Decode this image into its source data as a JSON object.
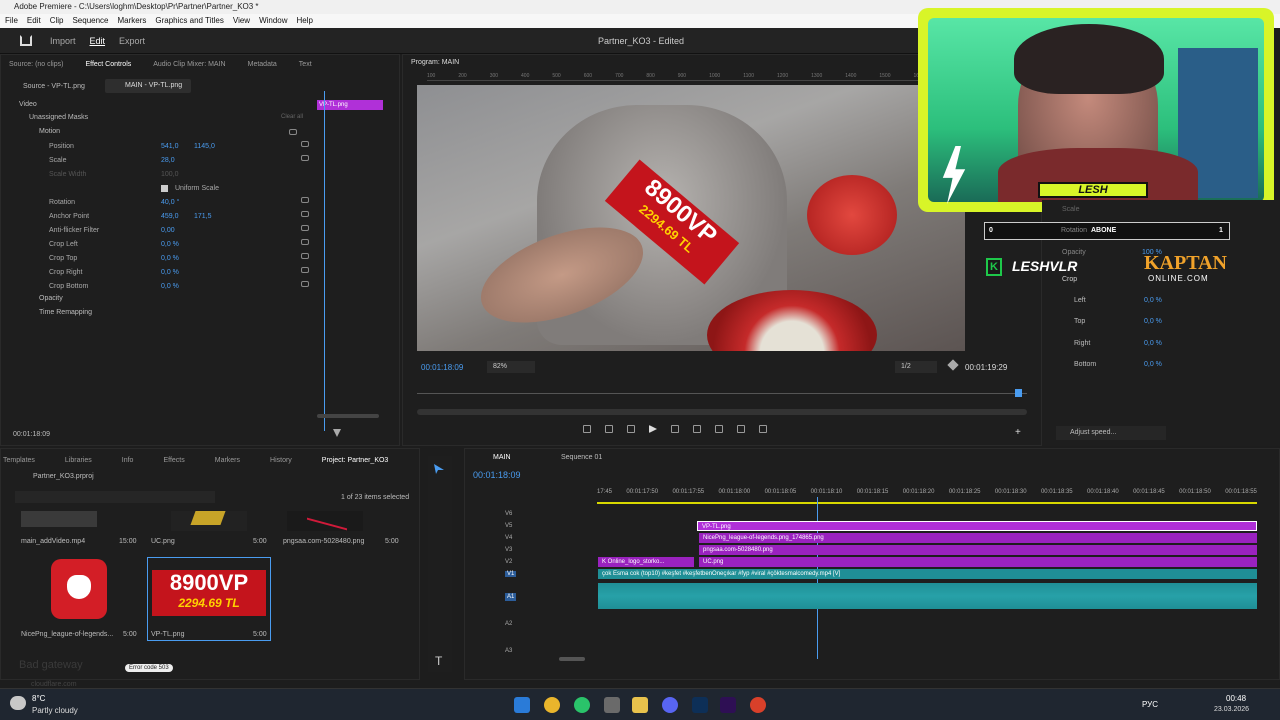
{
  "window": {
    "title": "Adobe Premiere - C:\\Users\\loghm\\Desktop\\Pr\\Partner\\Partner_KO3 *"
  },
  "menu": [
    "File",
    "Edit",
    "Clip",
    "Sequence",
    "Markers",
    "Graphics and Titles",
    "View",
    "Window",
    "Help"
  ],
  "workspace_tabs": {
    "import": "Import",
    "edit": "Edit",
    "export": "Export"
  },
  "project_title": "Partner_KO3 - Edited",
  "effect_controls": {
    "tabs": [
      "Source: (no clips)",
      "Effect Controls",
      "Audio Clip Mixer: MAIN",
      "Metadata",
      "Text"
    ],
    "source_clip": "Source - VP-TL.png",
    "main_clip": "MAIN - VP-TL.png",
    "timeline_clip": "VP-TL.png",
    "video_label": "Video",
    "unassigned_masks": "Unassigned Masks",
    "clear_all": "Clear all",
    "motion": "Motion",
    "rows": [
      {
        "name": "Position",
        "v1": "541,0",
        "v2": "1145,0"
      },
      {
        "name": "Scale",
        "v1": "28,0",
        "v2": ""
      },
      {
        "name": "Scale Width",
        "v1": "100,0",
        "v2": ""
      },
      {
        "name": "Uniform Scale",
        "v1": "",
        "v2": ""
      },
      {
        "name": "Rotation",
        "v1": "40,0 °",
        "v2": ""
      },
      {
        "name": "Anchor Point",
        "v1": "459,0",
        "v2": "171,5"
      },
      {
        "name": "Anti-flicker Filter",
        "v1": "0,00",
        "v2": ""
      },
      {
        "name": "Crop Left",
        "v1": "0,0 %",
        "v2": ""
      },
      {
        "name": "Crop Top",
        "v1": "0,0 %",
        "v2": ""
      },
      {
        "name": "Crop Right",
        "v1": "0,0 %",
        "v2": ""
      },
      {
        "name": "Crop Bottom",
        "v1": "0,0 %",
        "v2": ""
      }
    ],
    "opacity": "Opacity",
    "time_remapping": "Time Remapping",
    "timecode": "00:01:18:09"
  },
  "program": {
    "title": "Program: MAIN",
    "ruler": [
      "100",
      "200",
      "300",
      "400",
      "500",
      "600",
      "700",
      "800",
      "900",
      "1000",
      "1100",
      "1200",
      "1300",
      "1400",
      "1500",
      "1600",
      "1700",
      "1800",
      "1900"
    ],
    "left_timecode": "00:01:18:09",
    "zoom": "82%",
    "resolution": "1/2",
    "right_timecode": "00:01:19:29",
    "overlay_top": "8900VP",
    "overlay_bottom": "2294.69 TL"
  },
  "stream_overlay": {
    "name": "LESH",
    "rotation_label": "Rotation",
    "abone": "ABONE",
    "counter_left": "0",
    "counter_right": "1",
    "handle": "LESHVLR",
    "sponsor_top": "KAPTAN",
    "sponsor_bottom": "ONLINE.COM"
  },
  "right_panel": {
    "scale_label": "Scale",
    "opacity_label": "Opacity",
    "opacity_value": "100 %",
    "crop_label": "Crop",
    "rows": [
      {
        "name": "Left",
        "v": "0,0 %"
      },
      {
        "name": "Top",
        "v": "0,0 %"
      },
      {
        "name": "Right",
        "v": "0,0 %"
      },
      {
        "name": "Bottom",
        "v": "0,0 %"
      }
    ],
    "adjust_speed": "Adjust speed..."
  },
  "project": {
    "tabs": [
      "Templates",
      "Libraries",
      "Info",
      "Effects",
      "Markers",
      "History",
      "Project: Partner_KO3"
    ],
    "file": "Partner_KO3.prproj",
    "selected": "1 of 23 items selected",
    "items": [
      {
        "name": "main_addVideo.mp4",
        "dur": "15:00"
      },
      {
        "name": "UC.png",
        "dur": "5:00"
      },
      {
        "name": "pngsaa.com-5028480.png",
        "dur": "5:00"
      },
      {
        "name": "NicePng_league-of-legends...",
        "dur": "5:00"
      },
      {
        "name": "VP-TL.png",
        "dur": "5:00"
      }
    ],
    "thumb_top": "8900VP",
    "thumb_bottom": "2294.69 TL",
    "error_code": "Error code 503",
    "bad_gateway": "Bad gateway",
    "cloudflare": "cloudflare.com"
  },
  "timeline": {
    "tabs": [
      "MAIN",
      "Sequence 01"
    ],
    "timecode": "00:01:18:09",
    "ruler": [
      "17:45",
      "00:01:17:50",
      "00:01:17:55",
      "00:01:18:00",
      "00:01:18:05",
      "00:01:18:10",
      "00:01:18:15",
      "00:01:18:20",
      "00:01:18:25",
      "00:01:18:30",
      "00:01:18:35",
      "00:01:18:40",
      "00:01:18:45",
      "00:01:18:50",
      "00:01:18:55"
    ],
    "tracks": [
      "V6",
      "V5",
      "V4",
      "V3",
      "V2",
      "V1",
      "A1",
      "A2",
      "A3"
    ],
    "clips": {
      "v5": "VP-TL.png",
      "v4": "NicePng_league-of-legends.png_174865.png",
      "v3": "pngsaa.com-5028480.png",
      "v2": "UC.png",
      "v2b": "K Online_logo_storko...",
      "v1": "çok Esma cok (top10) #keşfet #keşfetbenOneçıkar #fyp #viral #çöktesmalcomedy.mp4 [V]"
    }
  },
  "taskbar": {
    "weather_temp": "8°C",
    "weather": "Partly cloudy",
    "lang": "РУС",
    "time": "00:48",
    "date": "23.03.2026"
  },
  "colors": {
    "accent": "#4a9cf0",
    "clip_purple": "#a020c8",
    "clip_teal": "#1f8f96",
    "overlay_green": "#d8f528"
  }
}
